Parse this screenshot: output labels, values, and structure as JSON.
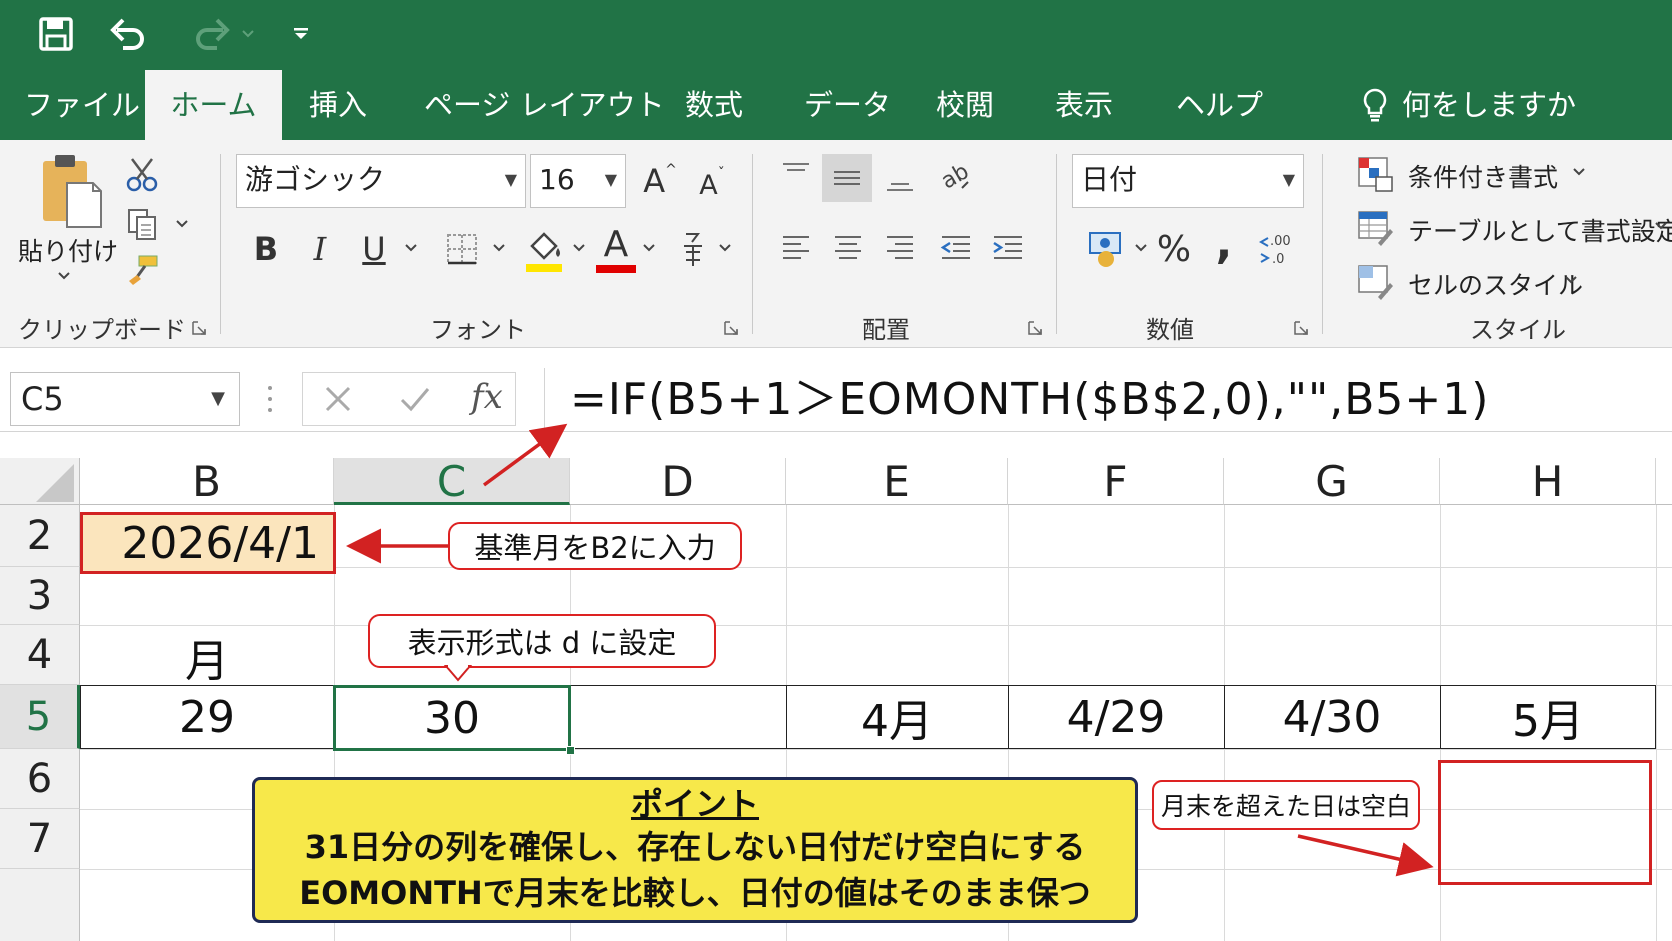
{
  "quick_access": {
    "save_icon": "save-icon",
    "undo_icon": "undo-icon",
    "redo_icon": "redo-icon",
    "customize_icon": "customize-qat-icon"
  },
  "tabs": [
    {
      "label": "ファイル"
    },
    {
      "label": "ホーム"
    },
    {
      "label": "挿入"
    },
    {
      "label": "ページ レイアウト"
    },
    {
      "label": "数式"
    },
    {
      "label": "データ"
    },
    {
      "label": "校閲"
    },
    {
      "label": "表示"
    },
    {
      "label": "ヘルプ"
    }
  ],
  "tell_me": {
    "label": "何をしますか"
  },
  "ribbon": {
    "clipboard": {
      "paste_label": "貼り付け",
      "group_label": "クリップボード"
    },
    "font": {
      "font_name": "游ゴシック",
      "font_size": "16",
      "bold": "B",
      "italic": "I",
      "underline": "U",
      "font_color_letter": "A",
      "grow_letter": "A",
      "shrink_letter": "A",
      "group_label": "フォント"
    },
    "alignment": {
      "group_label": "配置"
    },
    "number": {
      "format": "日付",
      "percent": "%",
      "comma": ",",
      "group_label": "数値"
    },
    "styles": {
      "conditional": "条件付き書式",
      "as_table": "テーブルとして書式設定",
      "cell_styles": "セルのスタイル",
      "group_label": "スタイル"
    }
  },
  "formula_bar": {
    "name_box": "C5",
    "fx": "fx",
    "formula": "=IF(B5+1＞EOMONTH($B$2,0),\"\",B5+1)"
  },
  "grid": {
    "columns": [
      "B",
      "C",
      "D",
      "E",
      "F",
      "G",
      "H"
    ],
    "rows": [
      "2",
      "3",
      "4",
      "5",
      "6",
      "7"
    ],
    "selected_column": "C",
    "selected_row": "5",
    "cells": {
      "B2": "2026/4/1",
      "B4": "月",
      "B5": "29",
      "C5": "30",
      "E5": "4月",
      "F5": "4/29",
      "G5": "4/30",
      "H5": "5月"
    }
  },
  "annotations": {
    "b2_callout": "基準月をB2に入力",
    "format_callout": "表示形式は d に設定",
    "month_end_callout": "月末を超えた日は空白",
    "point_title": "ポイント",
    "point_line1": "31日分の列を確保し、存在しない日付だけ空白にする",
    "point_line2": "EOMONTHで月末を比較し、日付の値はそのまま保つ"
  },
  "colors": {
    "excel_green": "#217346",
    "highlight_red": "#d22222",
    "input_fill": "#fbe5bd",
    "point_fill": "#f7e84a"
  }
}
